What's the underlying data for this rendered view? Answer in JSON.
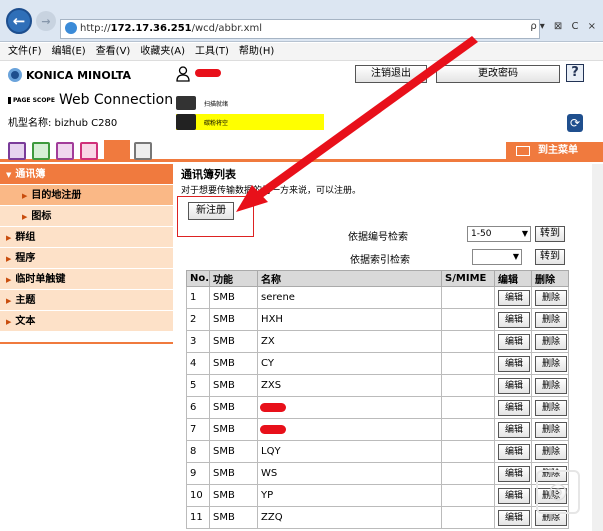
{
  "browser": {
    "url_prefix": "http://",
    "url_host": "172.17.36.251",
    "url_path": "/wcd/abbr.xml",
    "url_tools": "ρ▾ ⊠ C ×"
  },
  "menubar": [
    "文件(F)",
    "编辑(E)",
    "查看(V)",
    "收藏夹(A)",
    "工具(T)",
    "帮助(H)"
  ],
  "header": {
    "brand": "KONICA MINOLTA",
    "page_scope": "PAGE SCOPE",
    "product": "Web Connection",
    "model": "机型名称: bizhub C280",
    "logout": "注销退出",
    "change_password": "更改密码",
    "help": "?",
    "device_status_1": "扫描就绪",
    "device_status_2": "碳粉将空"
  },
  "tabbar": {
    "main_menu": "到主菜单"
  },
  "sidebar": {
    "address_book": "通讯簿",
    "destination": "目的地注册",
    "icon": "图标",
    "group": "群组",
    "program": "程序",
    "temp_single": "临时单触键",
    "subject": "主题",
    "text": "文本"
  },
  "content": {
    "title": "通讯簿列表",
    "desc": "对于想要传输数据的另一方来说，可以注册。",
    "new_button": "新注册",
    "search_number_label": "依据编号检索",
    "search_number_value": "1-50",
    "go1": "转到",
    "search_index_label": "依据索引检索",
    "search_index_value": "",
    "go2": "转到"
  },
  "table": {
    "headers": [
      "No.",
      "功能",
      "名称",
      "S/MIME",
      "编辑",
      "删除"
    ],
    "edit_label": "编辑",
    "delete_label": "删除",
    "rows": [
      {
        "no": "1",
        "func": "SMB",
        "name": "serene"
      },
      {
        "no": "2",
        "func": "SMB",
        "name": "HXH"
      },
      {
        "no": "3",
        "func": "SMB",
        "name": "ZX"
      },
      {
        "no": "4",
        "func": "SMB",
        "name": "CY"
      },
      {
        "no": "5",
        "func": "SMB",
        "name": "ZXS"
      },
      {
        "no": "6",
        "func": "SMB",
        "name": ""
      },
      {
        "no": "7",
        "func": "SMB",
        "name": ""
      },
      {
        "no": "8",
        "func": "SMB",
        "name": "LQY"
      },
      {
        "no": "9",
        "func": "SMB",
        "name": "WS"
      },
      {
        "no": "10",
        "func": "SMB",
        "name": "YP"
      },
      {
        "no": "11",
        "func": "SMB",
        "name": "ZZQ"
      }
    ]
  },
  "colors": {
    "accent": "#f07a3e",
    "annotation": "#e8101a"
  }
}
